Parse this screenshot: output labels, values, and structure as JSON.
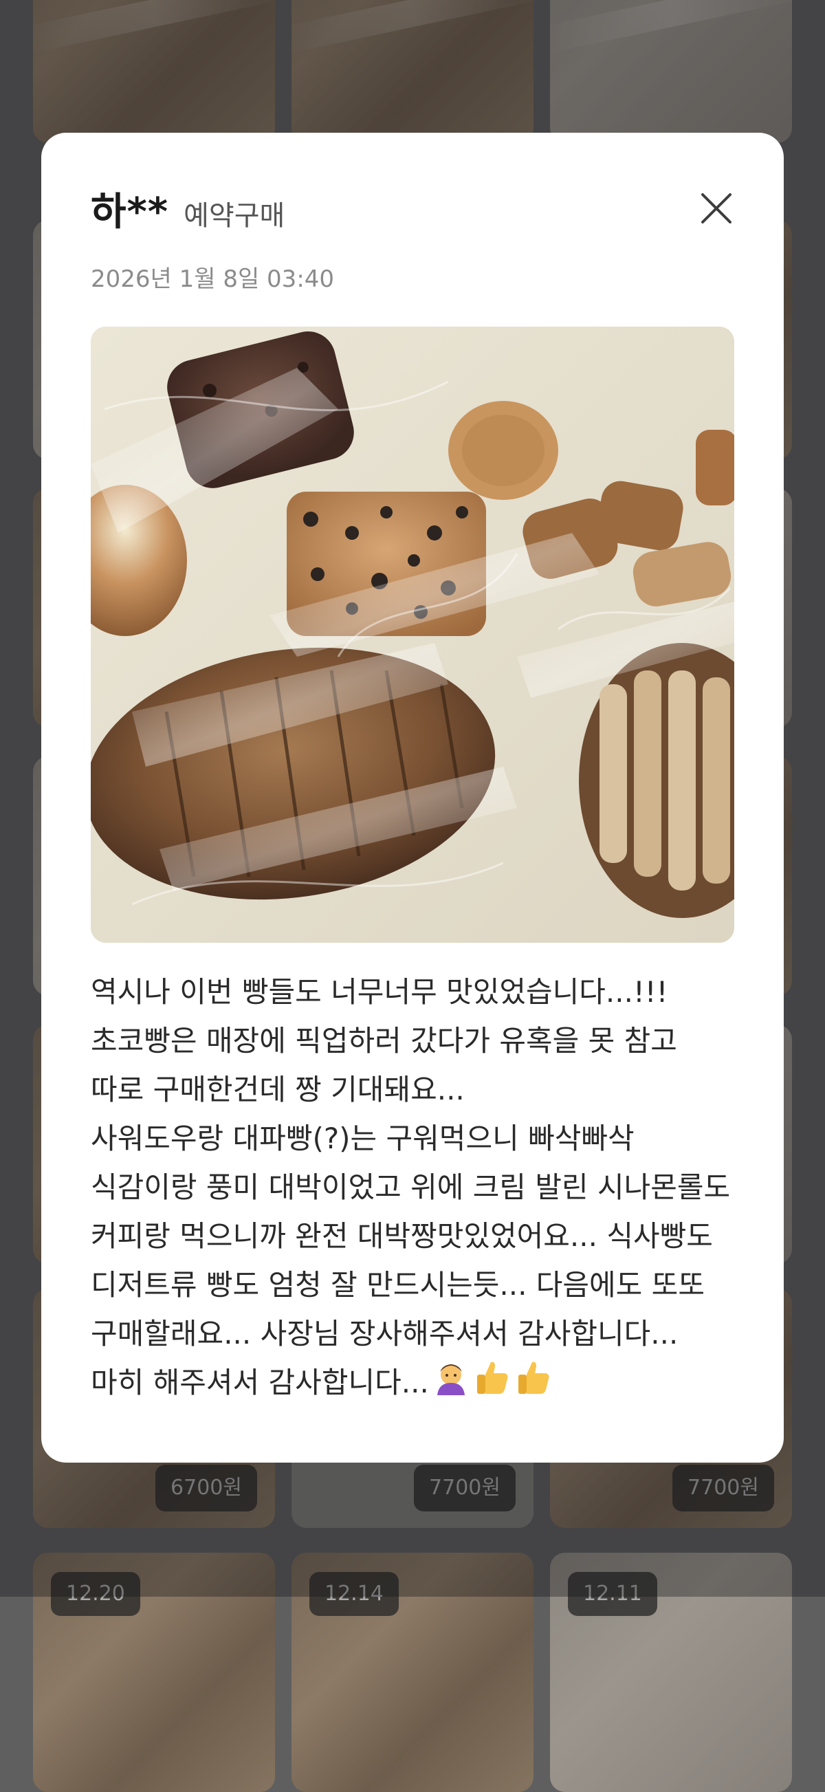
{
  "background_grid": {
    "prices": [
      "6700원",
      "7700원",
      "7700원"
    ],
    "dates": [
      "12.20",
      "12.14",
      "12.11"
    ]
  },
  "modal": {
    "reviewer": "하**",
    "purchase_type": "예약구매",
    "date": "2026년 1월 8일 03:40",
    "photo_icon": "bread-photo",
    "close_icon": "close-icon",
    "review_text": "역시나 이번 빵들도 너무너무 맛있었습니다...!!! 초코빵은 매장에 픽업하러 갔다가 유혹을 못 참고 따로 구매한건데 짱 기대돼요...\n사워도우랑 대파빵(?)는 구워먹으니 빠삭빠삭 식감이랑 풍미 대박이었고 위에 크림 발린 시나몬롤도 커피랑 먹으니까 완전 대박짱맛있었어요... 식사빵도 디저트류 빵도 엄청 잘 만드시는듯... 다음에도 또또 구매할래요... 사장님 장사해주셔서 감사합니다... 마히 해주셔서 감사합니다...",
    "review_emojis": [
      "bowing-person-icon",
      "thumbs-up-icon",
      "thumbs-up-icon"
    ]
  }
}
